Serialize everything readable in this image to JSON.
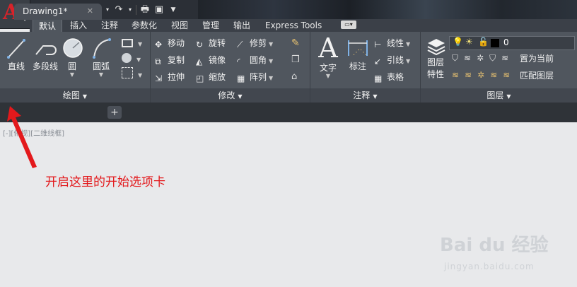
{
  "quick_access": {
    "icons": [
      "new-icon",
      "open-icon",
      "save-icon",
      "saveas-icon",
      "undo-icon",
      "redo-icon",
      "plot-icon",
      "workspace-icon",
      "customize-icon"
    ]
  },
  "tabs": [
    {
      "label": "默认",
      "active": true
    },
    {
      "label": "插入"
    },
    {
      "label": "注释"
    },
    {
      "label": "参数化"
    },
    {
      "label": "视图"
    },
    {
      "label": "管理"
    },
    {
      "label": "输出"
    },
    {
      "label": "Express Tools"
    }
  ],
  "draw": {
    "title": "绘图",
    "line": "直线",
    "polyline": "多段线",
    "circle": "圆",
    "arc": "圆弧"
  },
  "modify": {
    "title": "修改",
    "move": "移动",
    "rotate": "旋转",
    "trim": "修剪",
    "copy": "复制",
    "mirror": "镜像",
    "fillet": "圆角",
    "stretch": "拉伸",
    "scale": "缩放",
    "array": "阵列"
  },
  "annotation": {
    "title": "注释",
    "text": "文字",
    "dimension": "标注",
    "linear": "线性",
    "leader": "引线",
    "table": "表格"
  },
  "layers": {
    "title": "图层",
    "properties_line1": "图层",
    "properties_line2": "特性",
    "current_layer": "0",
    "make_current": "置为当前",
    "match_layer": "匹配图层"
  },
  "document": {
    "tab_name": "Drawing1*",
    "close": "✕",
    "new_tab": "+"
  },
  "canvas": {
    "viewport_label": "[-][俯视][二维线框]",
    "annotation": "开启这里的开始选项卡",
    "watermark": "Bai du 经验",
    "watermark_url": "jingyan.baidu.com"
  },
  "colors": {
    "accent_red": "#e3191c",
    "ribbon": "#50565e",
    "canvas": "#e8e9eb"
  }
}
